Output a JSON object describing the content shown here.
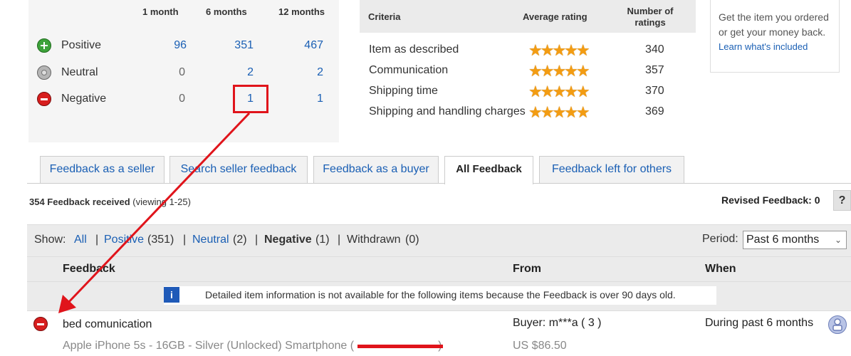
{
  "ratings": {
    "columns": [
      "1 month",
      "6 months",
      "12 months"
    ],
    "rows": [
      {
        "label": "Positive",
        "values": [
          "96",
          "351",
          "467"
        ]
      },
      {
        "label": "Neutral",
        "values": [
          "0",
          "2",
          "2"
        ]
      },
      {
        "label": "Negative",
        "values": [
          "0",
          "1",
          "1"
        ]
      }
    ]
  },
  "dsr": {
    "headers": {
      "criteria": "Criteria",
      "average": "Average rating",
      "number": "Number of ratings"
    },
    "rows": [
      {
        "criteria": "Item as described",
        "stars": "★★★★★",
        "count": "340"
      },
      {
        "criteria": "Communication",
        "stars": "★★★★★",
        "count": "357"
      },
      {
        "criteria": "Shipping time",
        "stars": "★★★★★",
        "count": "370"
      },
      {
        "criteria": "Shipping and handling charges",
        "stars": "★★★★★",
        "count": "369"
      }
    ]
  },
  "guarantee": {
    "text": "Get the item you ordered or get your money back.",
    "link": "Learn what's included"
  },
  "tabs": [
    {
      "label": "Feedback as a seller"
    },
    {
      "label": "Search seller feedback"
    },
    {
      "label": "Feedback as a buyer"
    },
    {
      "label": "All Feedback"
    },
    {
      "label": "Feedback left for others"
    }
  ],
  "received": {
    "bold": "354 Feedback received",
    "rest": "(viewing 1-25)"
  },
  "revised": {
    "label": "Revised Feedback: 0",
    "help": "?"
  },
  "filter": {
    "show": "Show:",
    "all": "All",
    "positive": "Positive",
    "positive_count": "(351)",
    "neutral": "Neutral",
    "neutral_count": "(2)",
    "negative": "Negative",
    "negative_count": "(1)",
    "withdrawn": "Withdrawn",
    "withdrawn_count": "(0)",
    "period_label": "Period:",
    "period_value": "Past 6 months"
  },
  "columns": {
    "feedback": "Feedback",
    "from": "From",
    "when": "When"
  },
  "info": {
    "icon": "i",
    "text": "Detailed item information is not available for the following items because the Feedback is over 90 days old."
  },
  "entry": {
    "comment": "bed comunication",
    "item": "Apple iPhone 5s - 16GB - Silver (Unlocked) Smartphone (",
    "item_close": ")",
    "from": "Buyer: m***a ( 3 )",
    "price": "US $86.50",
    "when": "During past 6 months"
  },
  "colors": {
    "link": "#1a5fb4",
    "annotation": "#e0141b",
    "star": "#f39c12"
  }
}
